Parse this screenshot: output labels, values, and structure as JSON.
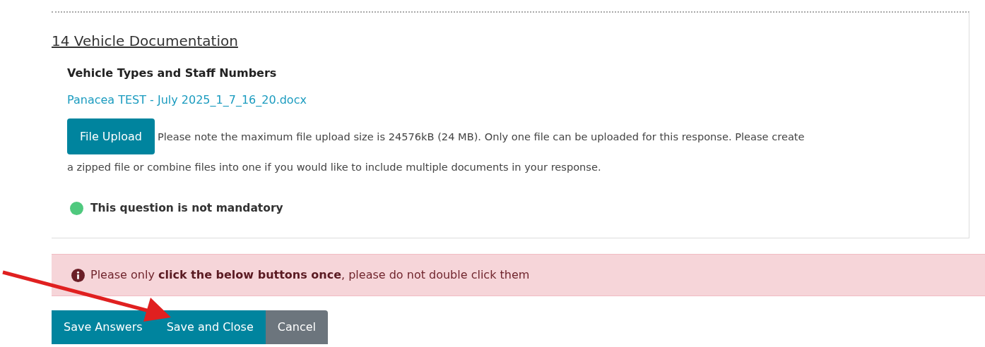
{
  "section": {
    "title": "14 Vehicle Documentation",
    "question": {
      "label": "Vehicle Types and Staff Numbers",
      "file_link": "Panacea TEST - July 2025_1_7_16_20.docx",
      "upload_button": "File Upload",
      "upload_note_lines": [
        "Please note the maximum file upload size is 24576kB (24 MB). Only one file can be uploaded for this response. Please create",
        "a zipped file or combine files into one if you would like to include multiple documents in your response."
      ],
      "status": {
        "text": "This question is not mandatory",
        "color": "#4fc97e"
      }
    }
  },
  "alert": {
    "message": "Please only **click the below buttons once**, please do not double click them"
  },
  "buttons": [
    {
      "label": "Save Answers",
      "kind": "primary"
    },
    {
      "label": "Save and Close",
      "kind": "primary"
    },
    {
      "label": "Cancel",
      "kind": "secondary"
    }
  ]
}
